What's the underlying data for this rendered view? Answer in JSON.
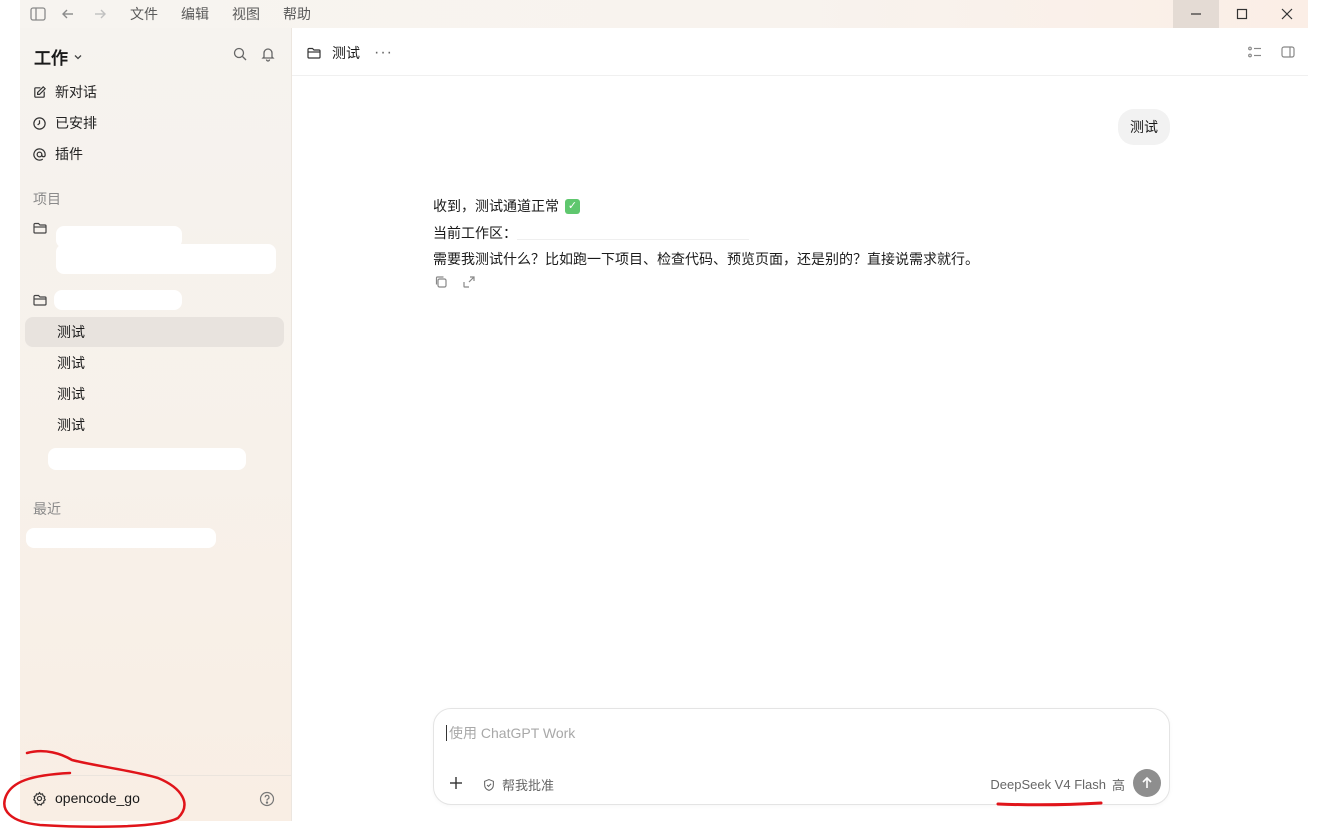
{
  "menu": {
    "items": [
      "文件",
      "编辑",
      "视图",
      "帮助"
    ]
  },
  "window_controls": {
    "minimize": "—",
    "maximize": "☐",
    "close": "✕"
  },
  "sidebar": {
    "workspace_title": "工作",
    "nav": [
      {
        "label": "新对话",
        "icon": "edit-icon"
      },
      {
        "label": "已安排",
        "icon": "clock-icon"
      },
      {
        "label": "插件",
        "icon": "at-icon"
      }
    ],
    "projects_label": "项目",
    "threads": [
      {
        "label": "测试",
        "selected": true
      },
      {
        "label": "测试",
        "selected": false
      },
      {
        "label": "测试",
        "selected": false
      },
      {
        "label": "测试",
        "selected": false
      }
    ],
    "recent_label": "最近",
    "account_name": "opencode_go"
  },
  "main": {
    "header_title": "测试",
    "more_label": "···",
    "user_message": "测试",
    "reply": {
      "line1": "收到，测试通道正常",
      "line2_label": "当前工作区：",
      "line3": "需要我测试什么？比如跑一下项目、检查代码、预览页面，还是别的？直接说需求就行。"
    }
  },
  "composer": {
    "placeholder": "使用 ChatGPT Work",
    "approve_label": "帮我批准",
    "model_label": "DeepSeek V4 Flash",
    "effort_label": "高"
  },
  "colors": {
    "annotation_red": "#e0141a",
    "send_button": "#8e8e8e",
    "selected_thread": "#e8e3de",
    "check_green": "#5fc76e"
  }
}
